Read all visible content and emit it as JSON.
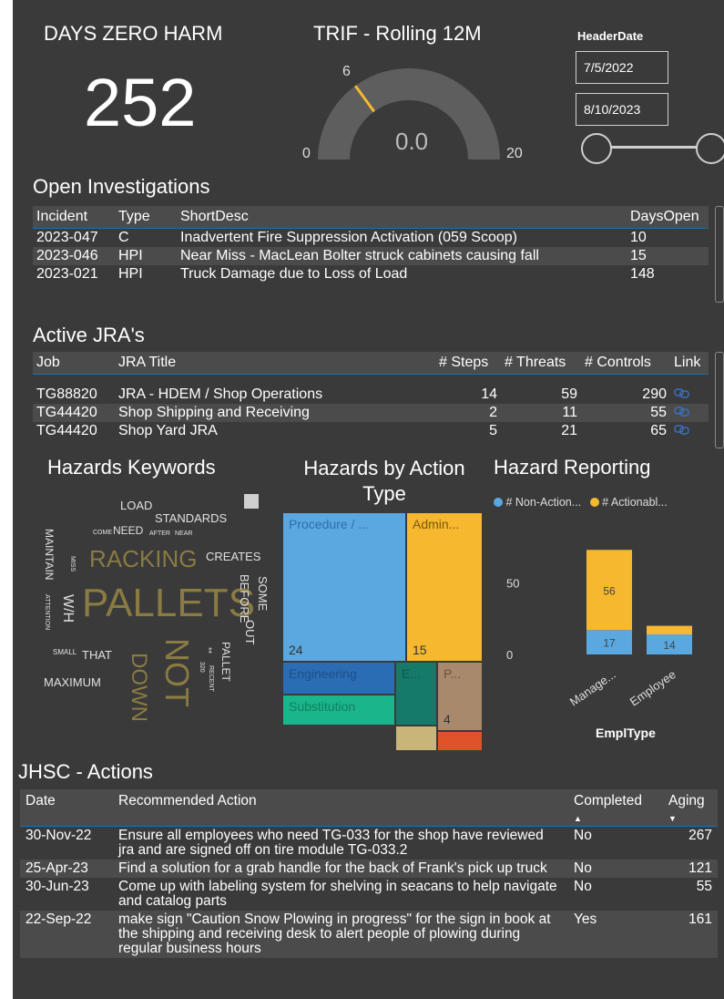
{
  "kpi": {
    "title": "DAYS ZERO HARM",
    "value": "252"
  },
  "gauge": {
    "title": "TRIF - Rolling 12M",
    "min": "0",
    "max": "20",
    "target": "6",
    "value": "0.0",
    "min_num": 0,
    "max_num": 20,
    "target_num": 6,
    "value_num": 0
  },
  "date_slicer": {
    "title": "HeaderDate",
    "start": "7/5/2022",
    "end": "8/10/2023"
  },
  "investigations": {
    "title": "Open Investigations",
    "columns": [
      "Incident",
      "Type",
      "ShortDesc",
      "DaysOpen"
    ],
    "rows": [
      [
        "2023-047",
        "C",
        "Inadvertent Fire Suppression Activation (059 Scoop)",
        "10"
      ],
      [
        "2023-046",
        "HPI",
        "Near Miss - MacLean Bolter struck cabinets causing fall",
        "15"
      ],
      [
        "2023-021",
        "HPI",
        "Truck Damage due to Loss of Load",
        "148"
      ]
    ]
  },
  "jra": {
    "title": "Active JRA's",
    "columns": [
      "Job",
      "JRA Title",
      "# Steps",
      "# Threats",
      "# Controls",
      "Link"
    ],
    "rows": [
      [
        "TG88820",
        "JRA - HDEM / Shop Operations",
        "14",
        "59",
        "290"
      ],
      [
        "TG44420",
        "Shop Shipping and Receiving",
        "2",
        "11",
        "55"
      ],
      [
        "TG44420",
        "Shop Yard JRA",
        "5",
        "21",
        "65"
      ]
    ],
    "link_icon": "link-icon"
  },
  "keywords": {
    "title": "Hazards Keywords",
    "words": [
      {
        "text": "PALLETS",
        "color": "#8a7a43"
      },
      {
        "text": "RACKING",
        "color": "#8a7a43"
      },
      {
        "text": "NOT",
        "color": "#8a7a43"
      },
      {
        "text": "DOWN",
        "color": "#8a7a43"
      },
      {
        "text": "LOAD",
        "color": "#e0e0e0"
      },
      {
        "text": "STANDARDS",
        "color": "#e0e0e0"
      },
      {
        "text": "NEED",
        "color": "#e0e0e0"
      },
      {
        "text": "COME",
        "color": "#e0e0e0"
      },
      {
        "text": "AFTER",
        "color": "#e0e0e0"
      },
      {
        "text": "NEAR",
        "color": "#e0e0e0"
      },
      {
        "text": "CREATES",
        "color": "#e0e0e0"
      },
      {
        "text": "MAINTAIN",
        "color": "#e0e0e0"
      },
      {
        "text": "MISS",
        "color": "#e0e0e0"
      },
      {
        "text": "W/H",
        "color": "#e0e0e0"
      },
      {
        "text": "ATTENTION",
        "color": "#e0e0e0"
      },
      {
        "text": "SOME",
        "color": "#e0e0e0"
      },
      {
        "text": "BEFORE",
        "color": "#e0e0e0"
      },
      {
        "text": "OUT",
        "color": "#e0e0e0"
      },
      {
        "text": "SMALL",
        "color": "#e0e0e0"
      },
      {
        "text": "THAT",
        "color": "#e0e0e0"
      },
      {
        "text": "MAXIMUM",
        "color": "#e0e0e0"
      },
      {
        "text": "PALLET",
        "color": "#e0e0e0"
      },
      {
        "text": "**",
        "color": "#e0e0e0"
      },
      {
        "text": "320",
        "color": "#e0e0e0"
      },
      {
        "text": "RECENT",
        "color": "#e0e0e0"
      }
    ]
  },
  "treemap": {
    "title": "Hazards by Action Type",
    "cells": [
      {
        "label": "Procedure / ...",
        "value": "24",
        "color": "#5ba8e0",
        "text_color": "#2e6ea8"
      },
      {
        "label": "Admin...",
        "value": "15",
        "color": "#f5b82e",
        "text_color": "#7a5a10"
      },
      {
        "label": "Engineering",
        "value": "",
        "color": "#2a6db4",
        "text_color": "#1e4f88"
      },
      {
        "label": "Substitution",
        "value": "",
        "color": "#1ab58a",
        "text_color": "#128060"
      },
      {
        "label": "E...",
        "value": "",
        "color": "#167a6a",
        "text_color": "#0e5a4c"
      },
      {
        "label": "P...",
        "value": "4",
        "color": "#a8896b",
        "text_color": "#6a5440"
      },
      {
        "label": "",
        "value": "",
        "color": "#c9b47a",
        "text_color": "#333"
      },
      {
        "label": "",
        "value": "",
        "color": "#e0522a",
        "text_color": "#333"
      }
    ]
  },
  "chart_data": {
    "type": "bar",
    "title": "Hazard Reporting",
    "xlabel": "EmplType",
    "ylabel": "",
    "categories": [
      "Manage...",
      "Employee"
    ],
    "series": [
      {
        "name": "# Non-Action...",
        "values": [
          17,
          14
        ],
        "color": "#5ba8e0"
      },
      {
        "name": "# Actionabl...",
        "values": [
          56,
          6
        ],
        "color": "#f5b82e"
      }
    ],
    "stacked": true,
    "ylim": [
      0,
      84
    ],
    "yticks": [
      "0",
      "50"
    ],
    "legend": "top",
    "grid": false
  },
  "jhsc": {
    "title": "JHSC - Actions",
    "columns": [
      "Date",
      "Recommended Action",
      "Completed",
      "Aging"
    ],
    "rows": [
      [
        "30-Nov-22",
        "Ensure all employees who need TG-033 for the shop have reviewed jra and are signed off on tire module TG-033.2",
        "No",
        "267"
      ],
      [
        "25-Apr-23",
        "Find a solution for a grab handle for the back of Frank's pick up truck",
        "No",
        "121"
      ],
      [
        "30-Jun-23",
        "Come up with labeling system for shelving in seacans to help navigate and catalog parts",
        "No",
        "55"
      ],
      [
        "22-Sep-22",
        "make sign \"Caution Snow Plowing in progress\" for the sign in book at the shipping and receiving desk to alert people of plowing during regular business hours",
        "Yes",
        "161"
      ]
    ]
  }
}
